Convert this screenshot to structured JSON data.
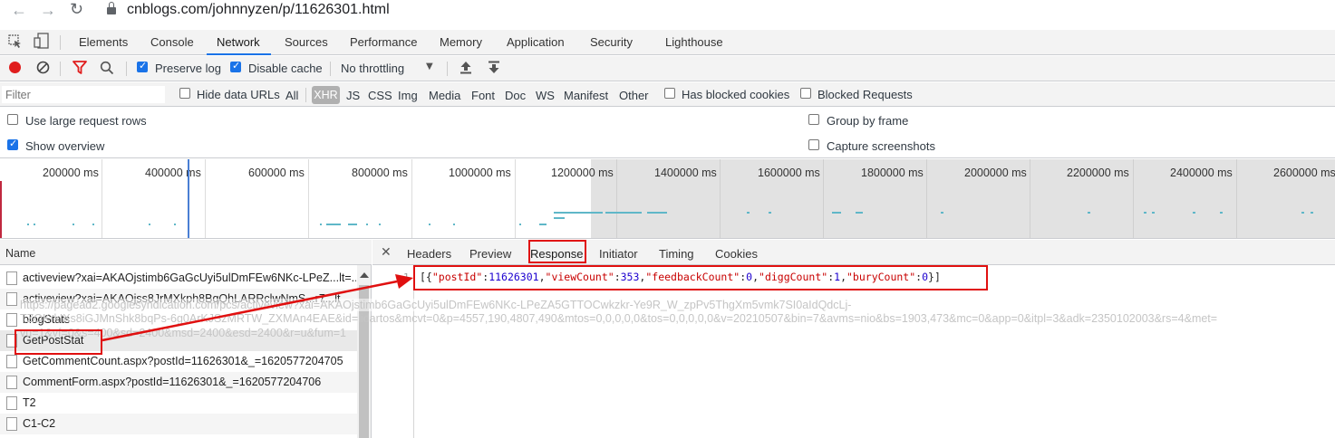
{
  "browser": {
    "url": "cnblogs.com/johnnyzen/p/11626301.html"
  },
  "devtools": {
    "tabs": [
      "Elements",
      "Console",
      "Network",
      "Sources",
      "Performance",
      "Memory",
      "Application",
      "Security",
      "Lighthouse"
    ],
    "active_tab": "Network"
  },
  "toolbar": {
    "preserve_log": "Preserve log",
    "disable_cache": "Disable cache",
    "throttling": "No throttling"
  },
  "filter": {
    "placeholder": "Filter",
    "hide_data_urls": "Hide data URLs",
    "types": [
      "All",
      "XHR",
      "JS",
      "CSS",
      "Img",
      "Media",
      "Font",
      "Doc",
      "WS",
      "Manifest",
      "Other"
    ],
    "selected_type": "XHR",
    "has_blocked_cookies": "Has blocked cookies",
    "blocked_requests": "Blocked Requests"
  },
  "options": {
    "large_rows": "Use large request rows",
    "show_overview": "Show overview",
    "group_by_frame": "Group by frame",
    "capture_screenshots": "Capture screenshots"
  },
  "overview": {
    "ticks": [
      "200000 ms",
      "400000 ms",
      "600000 ms",
      "800000 ms",
      "1000000 ms",
      "1200000 ms",
      "1400000 ms",
      "1600000 ms",
      "1800000 ms",
      "2000000 ms",
      "2200000 ms",
      "2400000 ms",
      "2600000 ms"
    ]
  },
  "requests": {
    "header": "Name",
    "rows": [
      "activeview?xai=AKAOjstimb6GaGcUyi5ulDmFEw6NKc-LPeZ...lt=...",
      "activeview?xai=AKAOjss8JrMXkph8BqQhLARRclwNmS...r7...lt",
      "blogStats",
      "GetPostStat",
      "GetCommentCount.aspx?postId=11626301&_=1620577204705",
      "CommentForm.aspx?postId=11626301&_=1620577204706",
      "T2",
      "C1-C2"
    ]
  },
  "detail": {
    "tabs": [
      "Headers",
      "Preview",
      "Response",
      "Initiator",
      "Timing",
      "Cookies"
    ],
    "active": "Response",
    "line_number": "1",
    "response": {
      "open": "[{",
      "k1": "\"postId\"",
      "v1": "11626301",
      "k2": "\"viewCount\"",
      "v2": "353",
      "k3": "\"feedbackCount\"",
      "v3": "0",
      "k4": "\"diggCount\"",
      "v4": "1",
      "k5": "\"buryCount\"",
      "v5": "0",
      "close": "}]"
    }
  },
  "ghost": {
    "line1": "https://pagead2.googlesyndication.com/pcs/activeview?xai=AKAOjstimb6GaGcUyi5ulDmFEw6NKc-LPeZA5GTTOCwkzkr-Ye9R_W_zpPv5ThgXm5vmk7SI0aIdQdcLj-",
    "line2": "TZOKrkIXs8iGJMnShk8bqPs-6g0ArKJSzMRTW_ZXMAn4EAE&id=lidartos&mcvt=0&p=4557,190,4807,490&mtos=0,0,0,0,0&tos=0,0,0,0,0&v=20210507&bin=7&avms=nio&bs=1903,473&mc=0&app=0&itpl=3&adk=2350102003&rs=4&met=",
    "line3": "vu=1&vf=0&s=400&sd=2400&msd=2400&esd=2400&r=u&fum=1"
  }
}
